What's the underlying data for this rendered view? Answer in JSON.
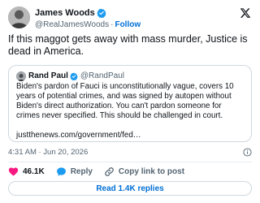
{
  "author": {
    "name": "James Woods",
    "handle": "@RealJamesWoods",
    "separator": "·",
    "follow_label": "Follow"
  },
  "tweet": {
    "text": "If this maggot gets away with mass murder, Justice is dead in America."
  },
  "quoted": {
    "name": "Rand Paul",
    "handle": "@RandPaul",
    "text": "Biden's pardon of Fauci is unconstitutionally vague, covers 10 years of potential crimes, and was signed by autopen without Biden's direct authorization. You can't pardon someone for crimes never specified. This should be challenged in court.",
    "link": "justthenews.com/government/fed…"
  },
  "meta": {
    "timestamp": "4:31 AM · Jun 20, 2026"
  },
  "actions": {
    "likes": "46.1K",
    "reply_label": "Reply",
    "copy_label": "Copy link to post"
  },
  "read_replies_label": "Read 1.4K replies",
  "icons": {
    "brand": "x-logo-icon",
    "verified": "verified-badge-icon",
    "info": "info-icon",
    "like": "heart-icon",
    "reply": "reply-bubble-icon",
    "copy": "link-icon"
  },
  "colors": {
    "verified": "#1d9bf0",
    "like": "#f91880",
    "link": "#006fd6"
  }
}
